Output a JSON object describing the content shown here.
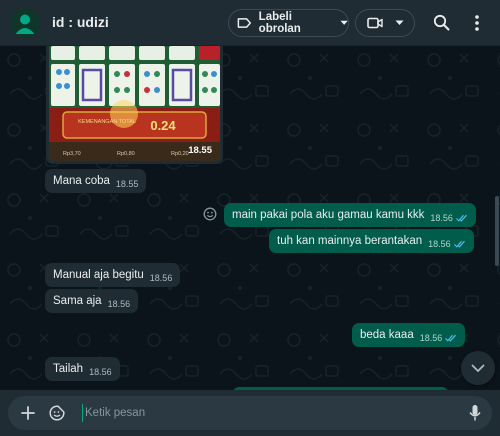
{
  "header": {
    "title": "id : udizi",
    "label_button": "Labeli obrolan",
    "icons": [
      "avatar-icon",
      "label-icon",
      "chevron-down-icon",
      "video-icon",
      "search-icon",
      "more-icon"
    ]
  },
  "messages": [
    {
      "direction": "in",
      "type": "image",
      "time": "18.55",
      "image_label": "KEMENANGAN TOTAL",
      "image_value": "0.24",
      "image_stats": [
        "Rp3,70",
        "Rp0,80",
        "Rp0,20"
      ]
    },
    {
      "direction": "in",
      "text": "Mana coba",
      "time": "18.55"
    },
    {
      "direction": "out",
      "text": "main pakai pola aku gamau kamu kkk",
      "time": "18.56",
      "status": "read"
    },
    {
      "direction": "out",
      "text": "tuh kan mainnya berantakan",
      "time": "18.56",
      "status": "read"
    },
    {
      "direction": "in",
      "text": "Manual aja begitu",
      "time": "18.56"
    },
    {
      "direction": "in",
      "text": "Sama aja",
      "time": "18.56"
    },
    {
      "direction": "out",
      "text": "beda kaaa",
      "time": "18.56",
      "status": "read"
    },
    {
      "direction": "in",
      "text": "Tailah",
      "time": "18.56"
    }
  ],
  "composer": {
    "placeholder": "Ketik pesan"
  },
  "colors": {
    "header_bg": "#202c33",
    "chat_bg": "#0b141a",
    "incoming_bubble": "#202c33",
    "outgoing_bubble": "#005c4b",
    "read_ticks": "#53bdeb",
    "accent": "#00a884"
  }
}
